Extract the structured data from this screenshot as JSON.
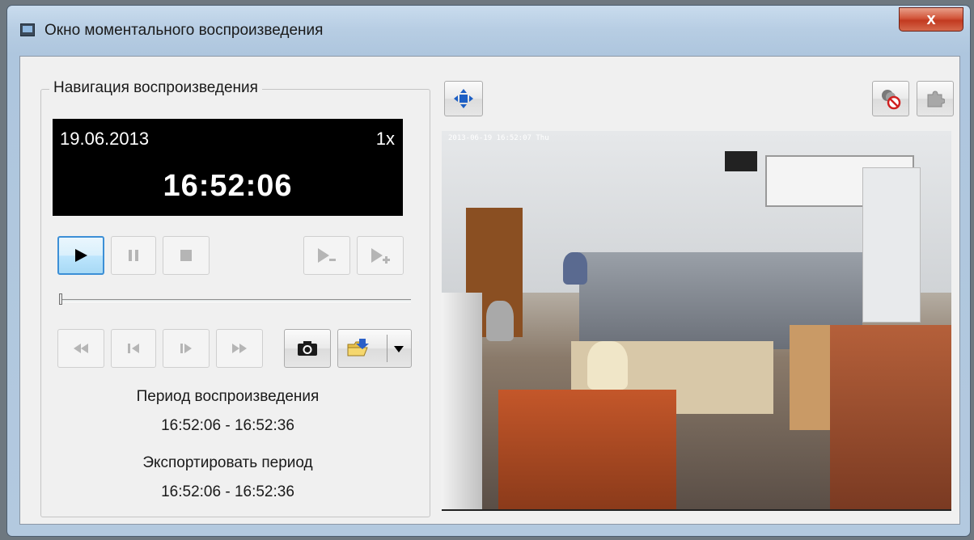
{
  "window": {
    "title": "Окно моментального воспроизведения",
    "close_label": "x"
  },
  "navigation": {
    "group_title": "Навигация воспроизведения",
    "date": "19.06.2013",
    "speed": "1x",
    "time": "16:52:06",
    "slider_position": 0
  },
  "playback_period": {
    "label": "Период воспроизведения",
    "value": "16:52:06 - 16:52:36"
  },
  "export_period": {
    "label": "Экспортировать период",
    "value": "16:52:06  - 16:52:36"
  },
  "video": {
    "timestamp": "2013-06-19 16:52:07 Thu"
  }
}
